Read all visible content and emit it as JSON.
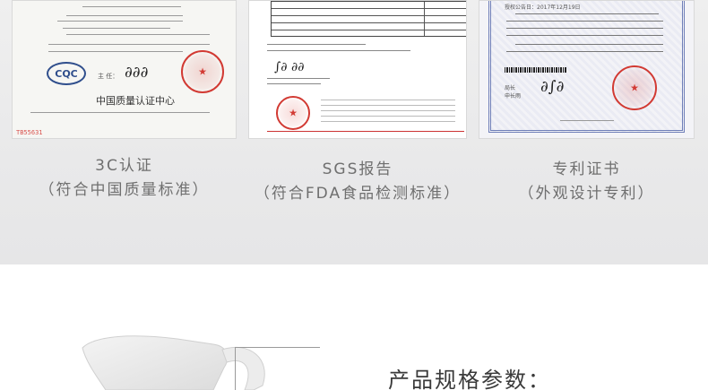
{
  "certificates": [
    {
      "id": "ccc",
      "caption_main": "3C认证",
      "caption_sub": "（符合中国质量标准）",
      "logo_text": "CQC",
      "org_name": "中国质量认证中心",
      "signer_label": "主  任：",
      "code": "TB55631"
    },
    {
      "id": "sgs",
      "caption_main": "SGS报告",
      "caption_sub": "（符合FDA食品检测标准）"
    },
    {
      "id": "patent",
      "caption_main": "专利证书",
      "caption_sub": "（外观设计专利）",
      "header_text": "授权公告日：2017年12月19日",
      "signer_label": "局长\n申长雨"
    }
  ],
  "spec_title": "产品规格参数：",
  "colors": {
    "band": "#ebebeb",
    "caption": "#6f6f6f",
    "seal_red": "#d23a33",
    "ccc_blue": "#2f4e8c"
  }
}
